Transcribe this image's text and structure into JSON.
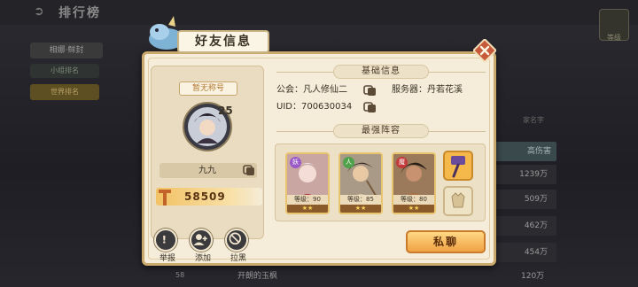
{
  "background": {
    "screen_title": "排行榜",
    "gift_label": "等级",
    "tab_filter": "相娜·鲜封",
    "tab_small_group": "小组排名",
    "tab_world": "世界排名",
    "column_header": "高伤害",
    "name_label": "家名字",
    "rows": [
      "1239万",
      "509万",
      "462万",
      "454万",
      "120万"
    ],
    "bottom_rank": "58",
    "bottom_player": "开朗的玉枫"
  },
  "dialog": {
    "title": "好友信息",
    "profile": {
      "nickname_badge": "暂无称号",
      "level": "25",
      "name": "九九",
      "power": "58509"
    },
    "actions": [
      {
        "label": "举报",
        "icon": "report-icon"
      },
      {
        "label": "添加",
        "icon": "add-friend-icon"
      },
      {
        "label": "拉黑",
        "icon": "block-icon"
      }
    ],
    "basic_info": {
      "header": "基础信息",
      "guild": "公会：凡人修仙二",
      "server": "服务器：丹若花溪",
      "uid": "UID：700630034"
    },
    "lineup": {
      "header": "最强阵容",
      "heroes": [
        {
          "tag": "妖",
          "level": "等级：90",
          "stars": "★★",
          "tag_color": "#9a5ac8"
        },
        {
          "tag": "人",
          "level": "等级：85",
          "stars": "★★",
          "tag_color": "#4fa24a"
        },
        {
          "tag": "魔",
          "level": "等级：80",
          "stars": "★★",
          "tag_color": "#c23a3a"
        }
      ]
    },
    "chat_button": "私聊"
  }
}
